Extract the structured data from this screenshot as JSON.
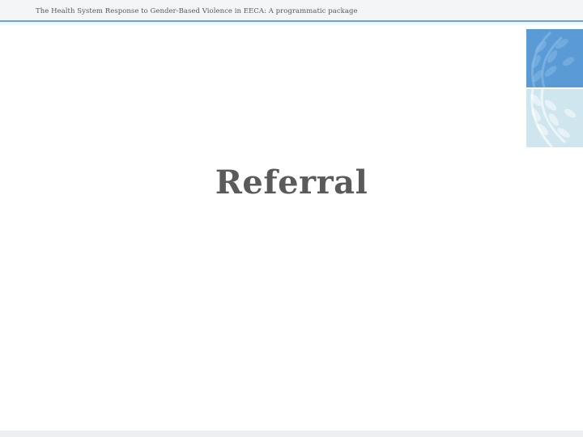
{
  "header": {
    "text": "The Health System Response to Gender-Based Violence in EECA: A programmatic package"
  },
  "slide": {
    "title": "Referral"
  },
  "colors": {
    "header_rule": "#6aa6da",
    "logo_upper": "#5b9bd5",
    "logo_lower": "#cfe6ee",
    "title": "#5a5a5a"
  },
  "icons": {
    "logo": "un-laurel-emblem-icon"
  }
}
